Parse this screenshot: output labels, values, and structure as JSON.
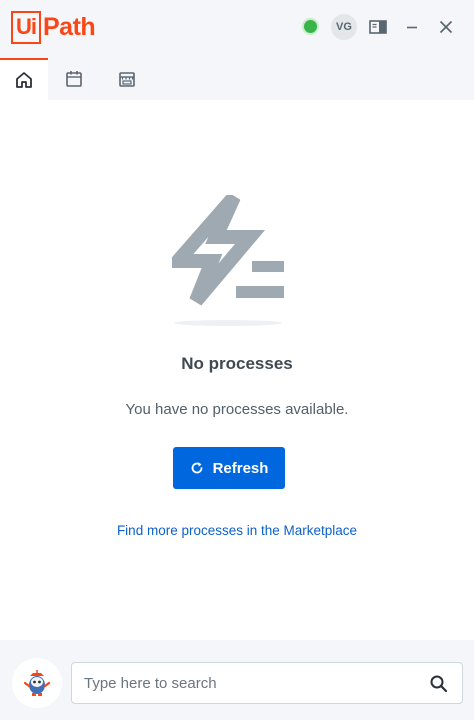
{
  "app": {
    "logo_box_text": "Ui",
    "logo_rest_text": "Path",
    "brand_color": "#fa4616"
  },
  "titlebar": {
    "status": "online",
    "status_color": "#38b449",
    "avatar_initials": "VG",
    "icons": [
      "status-dot",
      "panel-toggle-icon",
      "minimize-icon",
      "close-icon"
    ]
  },
  "tabs": [
    {
      "name": "home",
      "icon": "home-icon",
      "active": true
    },
    {
      "name": "calendar",
      "icon": "calendar-icon",
      "active": false
    },
    {
      "name": "marketplace",
      "icon": "store-icon",
      "active": false
    }
  ],
  "empty_state": {
    "illustration": "lightning-processes-illustration",
    "title": "No processes",
    "description": "You have no processes available.",
    "refresh_label": "Refresh",
    "refresh_icon": "refresh-icon",
    "marketplace_link": "Find more processes in the Marketplace",
    "accent_color": "#0067df"
  },
  "footer": {
    "assistant_icon": "robot-avatar-icon",
    "search_placeholder": "Type here to search",
    "search_value": ""
  }
}
